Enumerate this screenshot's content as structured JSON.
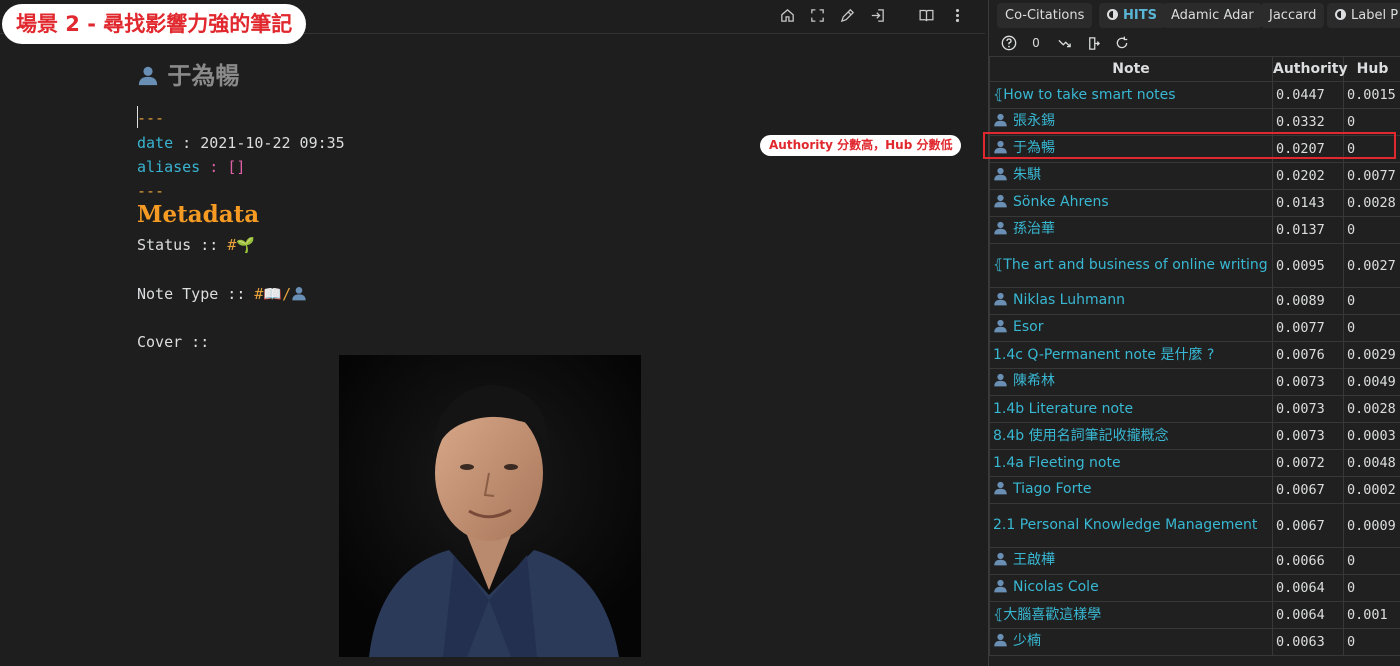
{
  "banner": "場景 2 - 尋找影響力強的筆記",
  "editor": {
    "title": "于為暢",
    "frontmatter_dash": "---",
    "date_key": "date",
    "date_sep": " : ",
    "date_value": "2021-10-22 09:35",
    "aliases_key": "aliases",
    "aliases_sep": " : ",
    "aliases_value": "[]",
    "heading": "Metadata",
    "status_label": "Status :: ",
    "status_tag": "#🌱",
    "note_type_label": "Note Type :: ",
    "note_type_tag": "#📖/",
    "cover_label": "Cover ::"
  },
  "callout": "Authority 分數高，Hub 分數低",
  "panel": {
    "tabs": [
      "Co-Citations",
      "HITS",
      "Adamic Adar",
      "Jaccard",
      "Label P"
    ],
    "active_tab": "HITS",
    "toolbar_count": "0",
    "columns": [
      "Note",
      "Authority",
      "Hub"
    ],
    "rows": [
      {
        "prefix": "⦃",
        "name": "How to take smart notes",
        "authority": "0.0447",
        "hub": "0.0015"
      },
      {
        "prefix": "person",
        "name": "張永錫",
        "authority": "0.0332",
        "hub": "0"
      },
      {
        "prefix": "person",
        "name": "于為暢",
        "authority": "0.0207",
        "hub": "0"
      },
      {
        "prefix": "person",
        "name": "朱騏",
        "authority": "0.0202",
        "hub": "0.0077"
      },
      {
        "prefix": "person",
        "name": "Sönke Ahrens",
        "authority": "0.0143",
        "hub": "0.0028"
      },
      {
        "prefix": "person",
        "name": "孫治華",
        "authority": "0.0137",
        "hub": "0"
      },
      {
        "prefix": "⦃",
        "name": "The art and business of online writing",
        "authority": "0.0095",
        "hub": "0.0027"
      },
      {
        "prefix": "person",
        "name": "Niklas Luhmann",
        "authority": "0.0089",
        "hub": "0"
      },
      {
        "prefix": "person",
        "name": "Esor",
        "authority": "0.0077",
        "hub": "0"
      },
      {
        "prefix": "",
        "name": "1.4c Q-Permanent note 是什麼 ?",
        "authority": "0.0076",
        "hub": "0.0029"
      },
      {
        "prefix": "person",
        "name": "陳希林",
        "authority": "0.0073",
        "hub": "0.0049"
      },
      {
        "prefix": "",
        "name": "1.4b Literature note",
        "authority": "0.0073",
        "hub": "0.0028"
      },
      {
        "prefix": "",
        "name": "8.4b 使用名詞筆記收攏概念",
        "authority": "0.0073",
        "hub": "0.0003"
      },
      {
        "prefix": "",
        "name": "1.4a Fleeting note",
        "authority": "0.0072",
        "hub": "0.0048"
      },
      {
        "prefix": "person",
        "name": "Tiago Forte",
        "authority": "0.0067",
        "hub": "0.0002"
      },
      {
        "prefix": "",
        "name": "2.1 Personal Knowledge Management",
        "authority": "0.0067",
        "hub": "0.0009"
      },
      {
        "prefix": "person",
        "name": "王啟樺",
        "authority": "0.0066",
        "hub": "0"
      },
      {
        "prefix": "person",
        "name": "Nicolas Cole",
        "authority": "0.0064",
        "hub": "0"
      },
      {
        "prefix": "⦃",
        "name": "大腦喜歡這樣學",
        "authority": "0.0064",
        "hub": "0.001"
      },
      {
        "prefix": "person",
        "name": "少楠",
        "authority": "0.0063",
        "hub": "0"
      }
    ]
  },
  "colors": {
    "accent": "#38b8d3",
    "banner_red": "#e0282e",
    "heading_orange": "#f59a23"
  },
  "icons": [
    "home-icon",
    "expand-icon",
    "edit-icon",
    "open-icon",
    "book-icon",
    "more-icon",
    "help-icon",
    "sort-icon",
    "export-icon",
    "refresh-icon",
    "person-icon"
  ]
}
